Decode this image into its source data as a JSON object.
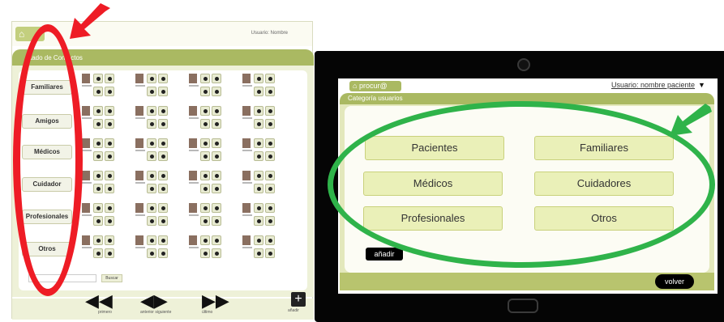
{
  "left_screen": {
    "home_label": "⌂",
    "user_label": "Usuario: Nombre",
    "header_title": "tado de Contactos",
    "categories": [
      {
        "label": "Familiares"
      },
      {
        "label": "Amigos"
      },
      {
        "label": "Médicos"
      },
      {
        "label": "Cuidador"
      },
      {
        "label": "Profesionales"
      },
      {
        "label": "Otros"
      }
    ],
    "search_placeholder": "",
    "search_button": "Buscar",
    "nav": {
      "first_label": "primero",
      "prev_next_label": "anterior siguiente",
      "last_label": "último",
      "add_label": "añadir",
      "add_symbol": "+"
    }
  },
  "right_screen": {
    "home_label": "procur@",
    "user_label": "Usuario: nombre paciente",
    "dropdown_symbol": "▼",
    "header_title": "Categoría usuarios",
    "categories": [
      {
        "label": "Pacientes"
      },
      {
        "label": "Familiares"
      },
      {
        "label": "Médicos"
      },
      {
        "label": "Cuidadores"
      },
      {
        "label": "Profesionales"
      },
      {
        "label": "Otros"
      }
    ],
    "add_button": "añadir",
    "back_button": "volver"
  },
  "colors": {
    "highlight_red": "#ee1c25",
    "highlight_green": "#2fb34a",
    "header_green": "#aab962",
    "button_green": "#eaf0b8"
  }
}
